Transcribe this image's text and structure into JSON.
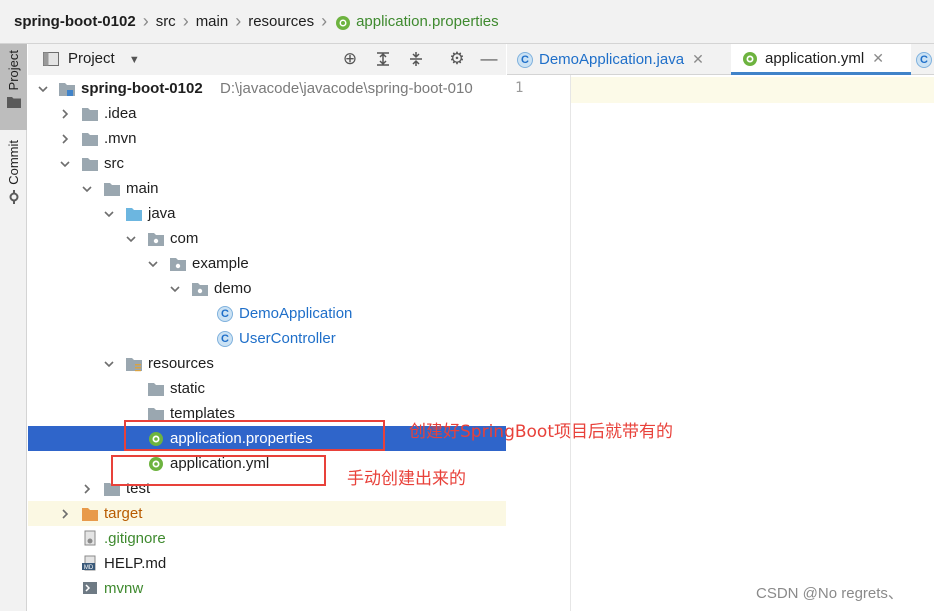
{
  "breadcrumb": {
    "project": "spring-boot-0102",
    "items": [
      "src",
      "main",
      "resources"
    ],
    "file": "application.properties"
  },
  "toolstrip": {
    "project_tab": "Project",
    "commit_tab": "Commit"
  },
  "project_panel": {
    "view_selector": "Project"
  },
  "tree": {
    "root": {
      "label": "spring-boot-0102",
      "path": "D:\\javacode\\javacode\\spring-boot-010"
    },
    "idea": ".idea",
    "mvn": ".mvn",
    "src": "src",
    "main": "main",
    "java": "java",
    "com": "com",
    "example": "example",
    "demo": "demo",
    "demo_app": "DemoApplication",
    "user_controller": "UserController",
    "resources": "resources",
    "static": "static",
    "templates": "templates",
    "app_properties": "application.properties",
    "app_yml": "application.yml",
    "test": "test",
    "target": "target",
    "gitignore": ".gitignore",
    "help": "HELP.md",
    "mvnw": "mvnw"
  },
  "editor": {
    "tabs": [
      {
        "label": "DemoApplication.java"
      },
      {
        "label": "application.yml"
      }
    ],
    "line_number": "1"
  },
  "annotations": {
    "properties_note": "创建好SpringBoot项目后就带有的",
    "yml_note": "手动创建出来的"
  },
  "watermark": "CSDN @No regrets、",
  "colors": {
    "selection": "#2f65ca",
    "annotation_red": "#e8413a",
    "excluded_bg": "#fbf8e3"
  }
}
